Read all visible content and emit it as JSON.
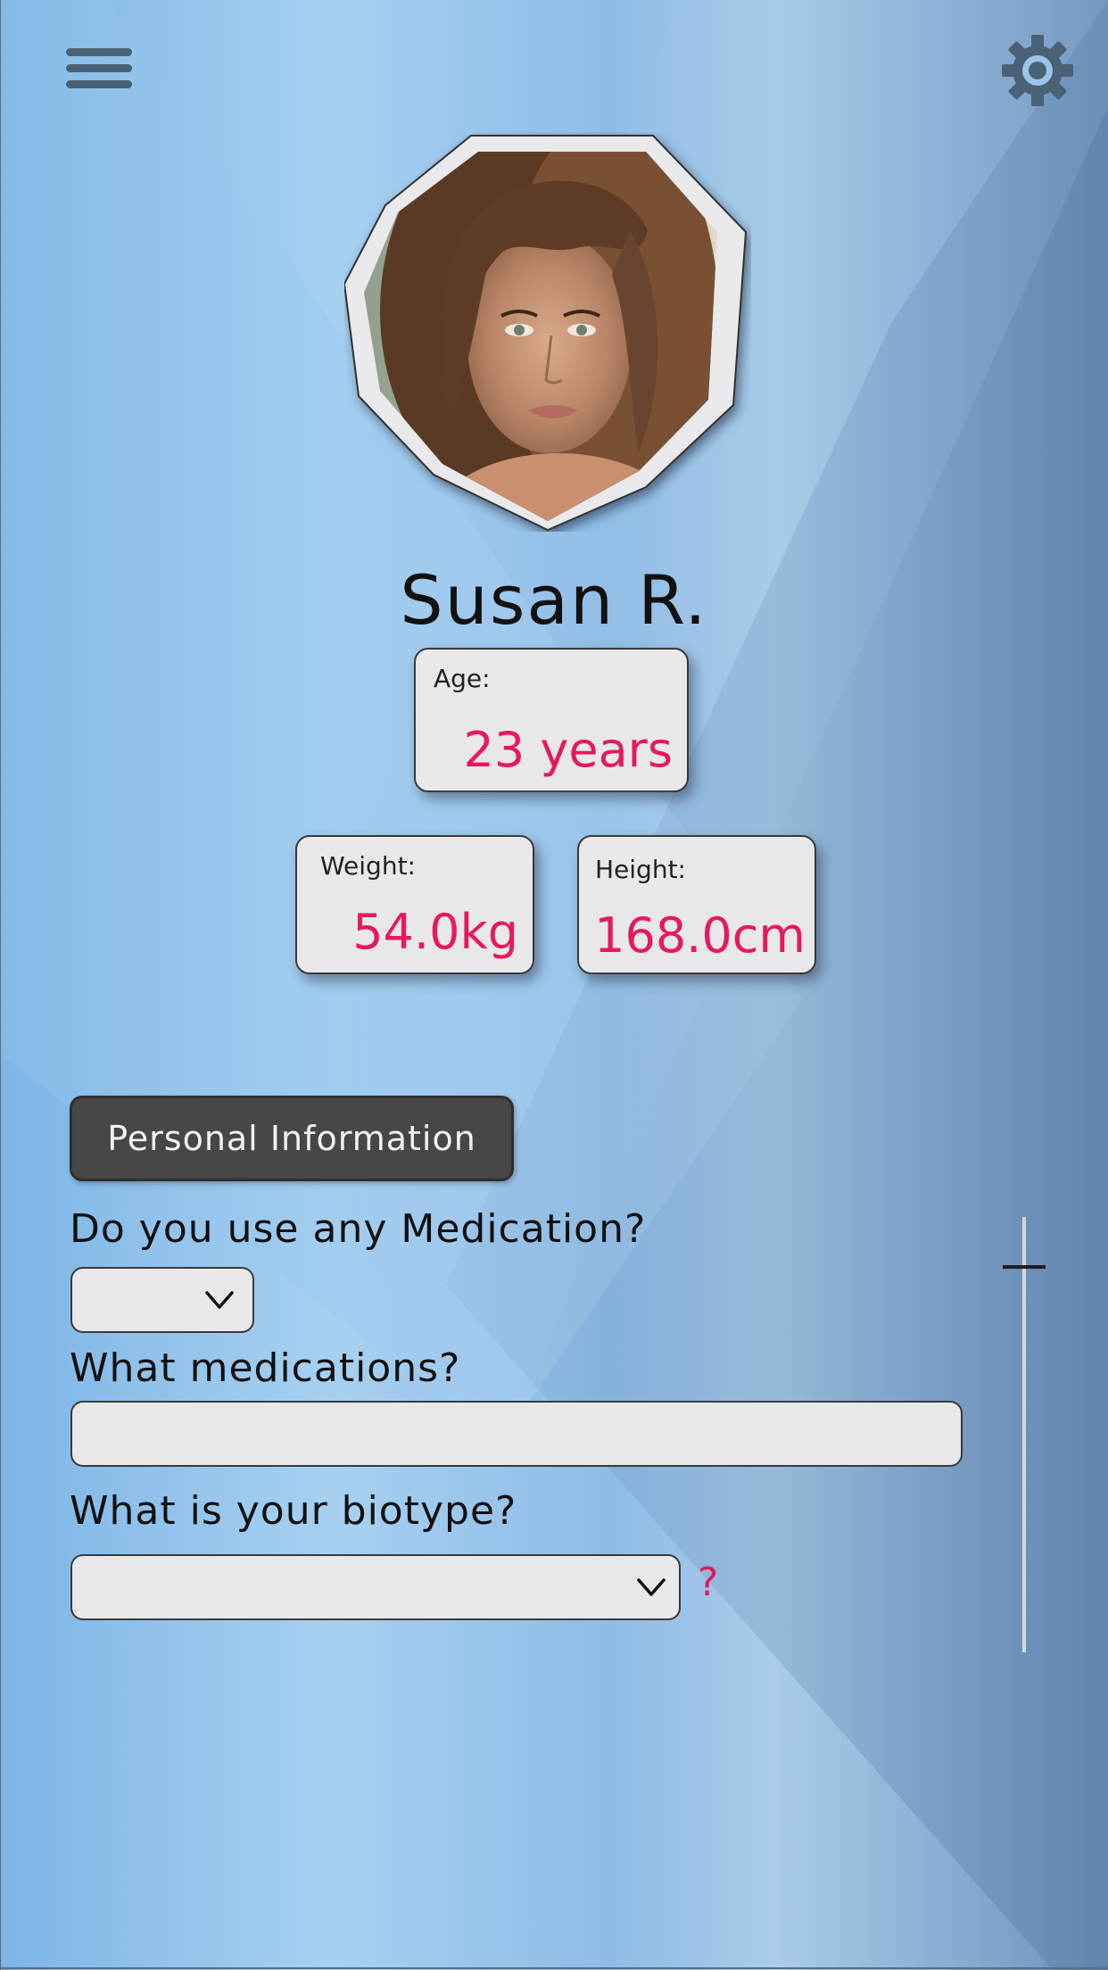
{
  "header": {
    "menu_icon": "hamburger-menu-icon",
    "settings_icon": "gear-icon"
  },
  "profile": {
    "name": "Susan R.",
    "age": {
      "label": "Age:",
      "value": "23 years"
    },
    "weight": {
      "label": "Weight:",
      "value": "54.0kg"
    },
    "height": {
      "label": "Height:",
      "value": "168.0cm"
    }
  },
  "section": {
    "button_label": "Personal Information"
  },
  "form": {
    "medication_question": "Do you use any Medication?",
    "medication_select_value": "",
    "medications_question": "What medications?",
    "medications_input_value": "",
    "biotype_question": "What is your biotype?",
    "biotype_select_value": "",
    "biotype_help": "?"
  },
  "colors": {
    "accent": "#e8185f",
    "card_bg": "#e8e8ea",
    "button_bg": "#474747",
    "icon": "#4a6176"
  }
}
